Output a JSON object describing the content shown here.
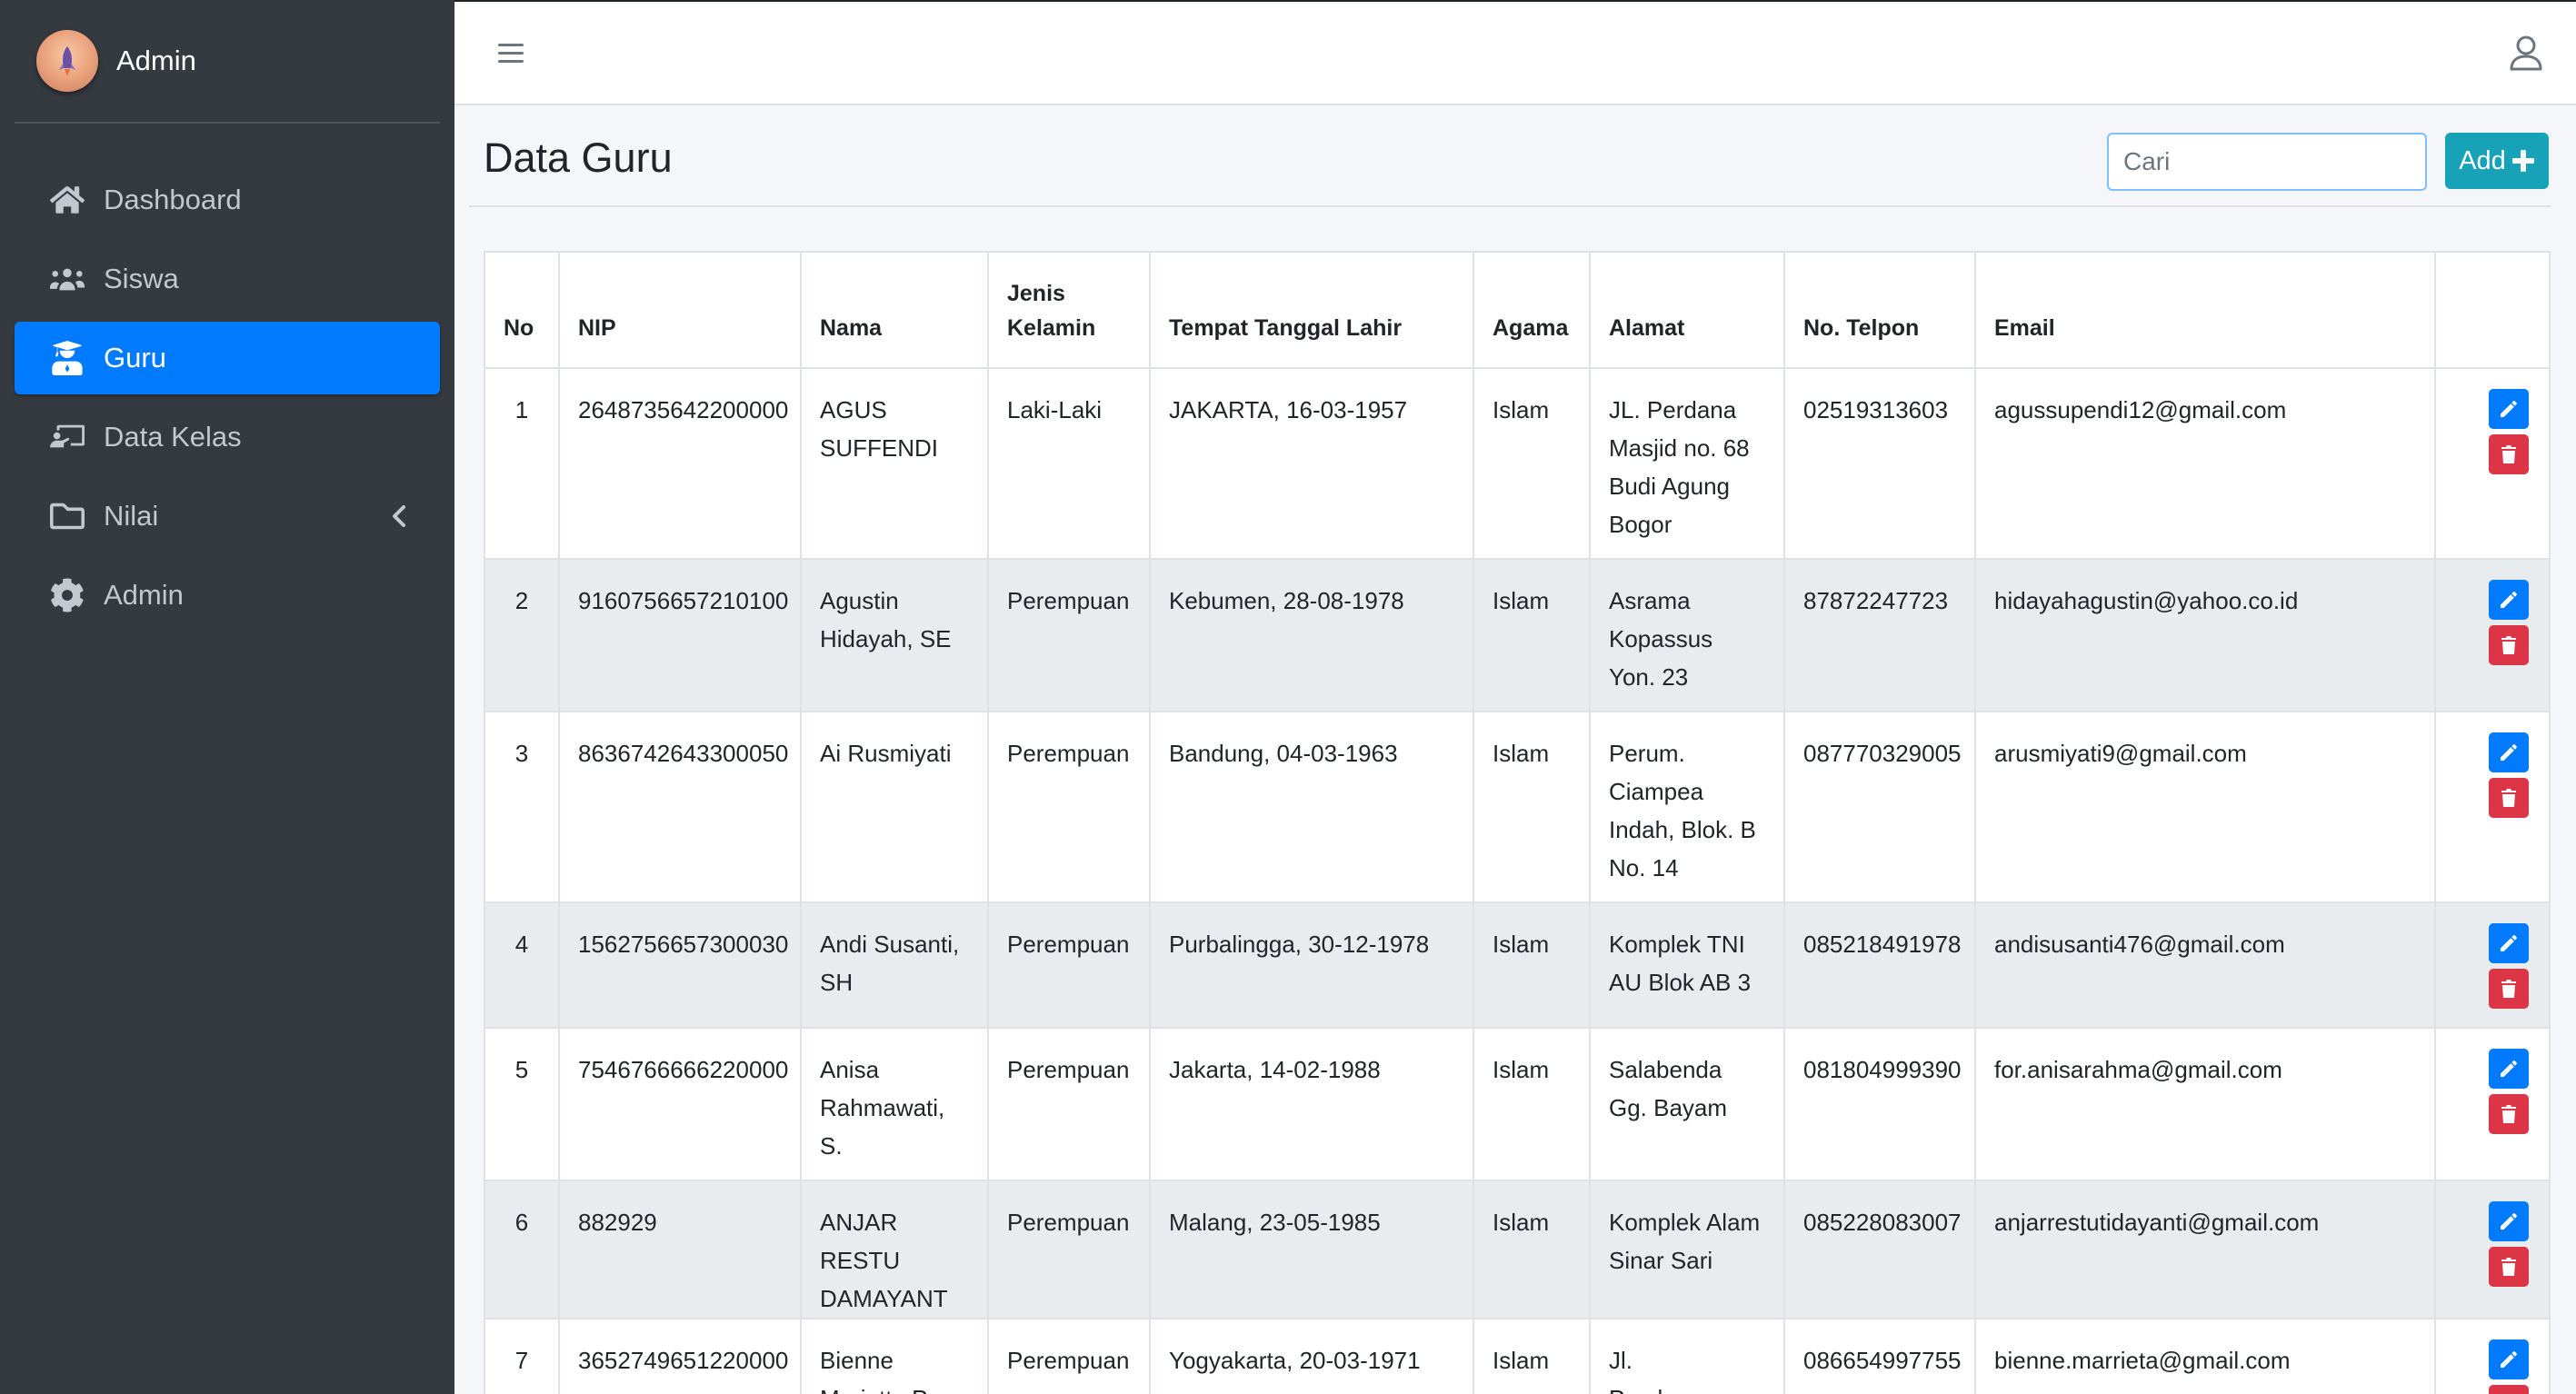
{
  "brand": {
    "title": "Admin"
  },
  "sidebar": {
    "items": [
      {
        "label": "Dashboard",
        "icon": "home-icon"
      },
      {
        "label": "Siswa",
        "icon": "users-icon"
      },
      {
        "label": "Guru",
        "icon": "graduate-icon"
      },
      {
        "label": "Data Kelas",
        "icon": "chalkboard-icon"
      },
      {
        "label": "Nilai",
        "icon": "folder-icon"
      },
      {
        "label": "Admin",
        "icon": "gear-icon"
      }
    ],
    "active": "Guru"
  },
  "page": {
    "title": "Data Guru",
    "search_placeholder": "Cari",
    "add_label": "Add"
  },
  "table": {
    "headers": {
      "no": "No",
      "nip": "NIP",
      "nama": "Nama",
      "jk_line1": "Jenis",
      "jk_line2": "Kelamin",
      "ttl": "Tempat Tanggal Lahir",
      "agama": "Agama",
      "alamat": "Alamat",
      "tel": "No. Telpon",
      "email": "Email"
    },
    "rows": [
      {
        "no": "1",
        "nip": "2648735642200000",
        "nama": "AGUS SUFFENDI",
        "jk": "Laki-Laki",
        "ttl": "JAKARTA, 16-03-1957",
        "agama": "Islam",
        "alamat": "JL. Perdana Masjid no. 68 Budi Agung Bogor",
        "tel": "02519313603",
        "email": "agussupendi12@gmail.com"
      },
      {
        "no": "2",
        "nip": "9160756657210100",
        "nama": "Agustin Hidayah, SE",
        "jk": "Perempuan",
        "ttl": "Kebumen, 28-08-1978",
        "agama": "Islam",
        "alamat": "Asrama Kopassus Yon. 23",
        "tel": "87872247723",
        "email": "hidayahagustin@yahoo.co.id"
      },
      {
        "no": "3",
        "nip": "8636742643300050",
        "nama": "Ai Rusmiyati",
        "jk": "Perempuan",
        "ttl": "Bandung, 04-03-1963",
        "agama": "Islam",
        "alamat": "Perum. Ciampea Indah, Blok. B No. 14",
        "tel": "087770329005",
        "email": "arusmiyati9@gmail.com"
      },
      {
        "no": "4",
        "nip": "1562756657300030",
        "nama": "Andi Susanti, SH",
        "jk": "Perempuan",
        "ttl": "Purbalingga, 30-12-1978",
        "agama": "Islam",
        "alamat": "Komplek TNI AU Blok AB 3",
        "tel": "085218491978",
        "email": "andisusanti476@gmail.com"
      },
      {
        "no": "5",
        "nip": "7546766666220000",
        "nama": "Anisa Rahmawati, S.",
        "jk": "Perempuan",
        "ttl": "Jakarta, 14-02-1988",
        "agama": "Islam",
        "alamat": "Salabenda Gg. Bayam",
        "tel": "081804999390",
        "email": "for.anisarahma@gmail.com"
      },
      {
        "no": "6",
        "nip": "882929",
        "nama": "ANJAR RESTU DAMAYANT",
        "jk": "Perempuan",
        "ttl": "Malang, 23-05-1985",
        "agama": "Islam",
        "alamat": "Komplek Alam Sinar Sari",
        "tel": "085228083007",
        "email": "anjarrestutidayanti@gmail.com"
      },
      {
        "no": "7",
        "nip": "3652749651220000",
        "nama": "Bienne Marietta Praw",
        "jk": "Perempuan",
        "ttl": "Yogyakarta, 20-03-1971",
        "agama": "Islam",
        "alamat": "Jl. Pembangunan",
        "tel": "086654997755",
        "email": "bienne.marrieta@gmail.com"
      }
    ]
  },
  "colors": {
    "sidebar_bg": "#343a40",
    "active_nav": "#007bff",
    "add_button": "#17a2b8",
    "edit_button": "#007bff",
    "delete_button": "#dc3545"
  }
}
